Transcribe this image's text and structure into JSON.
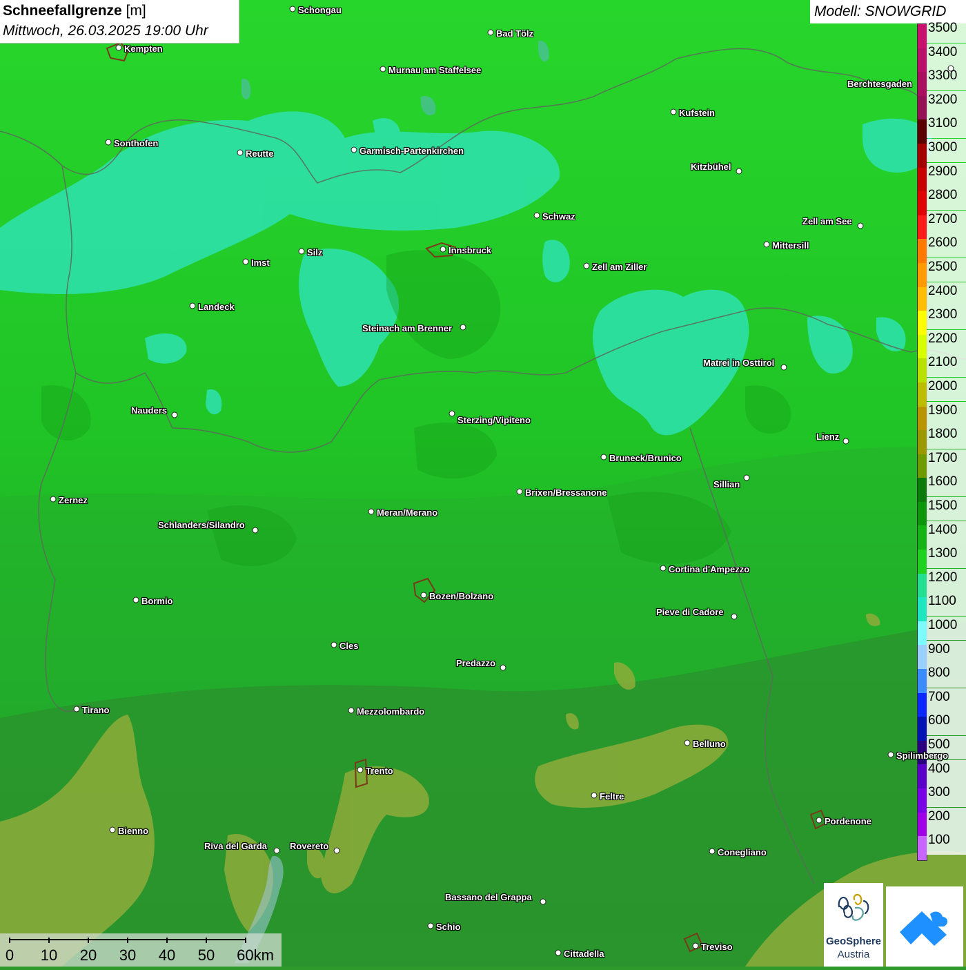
{
  "title": {
    "main": "Schneefallgrenze",
    "unit": "[m]",
    "datetime": "Mittwoch, 26.03.2025 19:00 Uhr"
  },
  "model": "Modell: SNOWGRID",
  "legend": {
    "labels": [
      "3500",
      "3400",
      "3300",
      "3200",
      "3100",
      "3000",
      "2900",
      "2800",
      "2700",
      "2600",
      "2500",
      "2400",
      "2300",
      "2200",
      "2100",
      "2000",
      "1900",
      "1800",
      "1700",
      "1600",
      "1500",
      "1400",
      "1300",
      "1200",
      "1100",
      "1000",
      "900",
      "800",
      "700",
      "600",
      "500",
      "400",
      "300",
      "200",
      "100"
    ],
    "colors": [
      "#c8106e",
      "#b80f6a",
      "#a8105f",
      "#961056",
      "#5a0000",
      "#a30000",
      "#c80000",
      "#e00000",
      "#ff1a1a",
      "#ff7a00",
      "#ff9a00",
      "#ffbf00",
      "#ffff00",
      "#d8ff00",
      "#b8e000",
      "#bcbc00",
      "#b89400",
      "#9a9a00",
      "#6f9a00",
      "#0a7a0a",
      "#0b960b",
      "#14b414",
      "#1fd21f",
      "#22e090",
      "#1ee6c0",
      "#7cfcff",
      "#9ad0ff",
      "#3a8cff",
      "#0a28ff",
      "#0014b4",
      "#2a0080",
      "#5a00c8",
      "#7a00e6",
      "#a000e6",
      "#c864ff"
    ]
  },
  "cities": [
    {
      "name": "Schongau"
    },
    {
      "name": "Kempten"
    },
    {
      "name": "Bad Tölz"
    },
    {
      "name": "Murnau am Staffelsee"
    },
    {
      "name": "Berchtesgaden"
    },
    {
      "name": "Kufstein"
    },
    {
      "name": "Sonthofen"
    },
    {
      "name": "Reutte"
    },
    {
      "name": "Garmisch-Partenkirchen"
    },
    {
      "name": "Kitzbühel"
    },
    {
      "name": "Schwaz"
    },
    {
      "name": "Zell am See"
    },
    {
      "name": "Mittersill"
    },
    {
      "name": "Innsbruck"
    },
    {
      "name": "Imst"
    },
    {
      "name": "Silz"
    },
    {
      "name": "Zell am Ziller"
    },
    {
      "name": "Landeck"
    },
    {
      "name": "Steinach am Brenner"
    },
    {
      "name": "Matrei in Osttirol"
    },
    {
      "name": "Nauders"
    },
    {
      "name": "Sterzing/Vipiteno"
    },
    {
      "name": "Lienz"
    },
    {
      "name": "Bruneck/Brunico"
    },
    {
      "name": "Sillian"
    },
    {
      "name": "Brixen/Bressanone"
    },
    {
      "name": "Zernez"
    },
    {
      "name": "Meran/Merano"
    },
    {
      "name": "Schlanders/Silandro"
    },
    {
      "name": "Cortina d'Ampezzo"
    },
    {
      "name": "Bozen/Bolzano"
    },
    {
      "name": "Bormio"
    },
    {
      "name": "Pieve di Cadore"
    },
    {
      "name": "Cles"
    },
    {
      "name": "Predazzo"
    },
    {
      "name": "Tirano"
    },
    {
      "name": "Mezzolombardo"
    },
    {
      "name": "Belluno"
    },
    {
      "name": "Spilimbergo"
    },
    {
      "name": "Trento"
    },
    {
      "name": "Feltre"
    },
    {
      "name": "Pordenone"
    },
    {
      "name": "Bienno"
    },
    {
      "name": "Riva del Garda"
    },
    {
      "name": "Rovereto"
    },
    {
      "name": "Conegliano"
    },
    {
      "name": "Bassano del Grappa"
    },
    {
      "name": "Schio"
    },
    {
      "name": "Treviso"
    },
    {
      "name": "Cittadella"
    }
  ],
  "scalebar": {
    "ticks": [
      "0",
      "10",
      "20",
      "30",
      "40",
      "50",
      "60km"
    ]
  },
  "logos": {
    "geosphere_line1": "GeoSphere",
    "geosphere_line2": "Austria",
    "geosphere_icon": "geosphere-austria-logo",
    "app_icon": "weather-app-logo"
  }
}
